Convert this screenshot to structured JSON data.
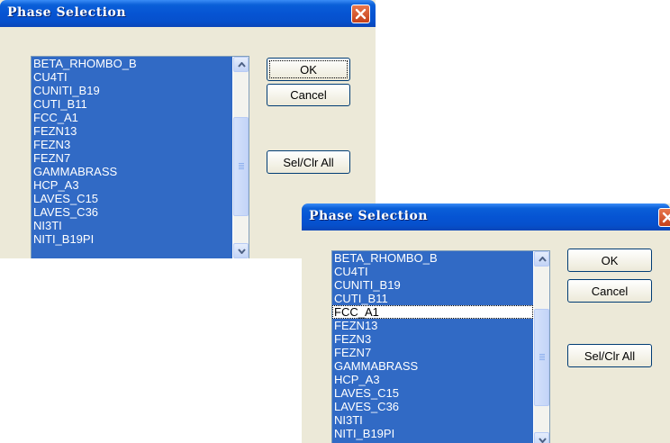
{
  "dialog_top": {
    "title": "Phase Selection",
    "phases": [
      "BETA_RHOMBO_B",
      "CU4TI",
      "CUNITI_B19",
      "CUTI_B11",
      "FCC_A1",
      "FEZN13",
      "FEZN3",
      "FEZN7",
      "GAMMABRASS",
      "HCP_A3",
      "LAVES_C15",
      "LAVES_C36",
      "NI3TI",
      "NITI_B19PI"
    ],
    "ok_label": "OK",
    "cancel_label": "Cancel",
    "select_clear_label": "Sel/Clr All"
  },
  "dialog_bottom": {
    "title": "Phase Selection",
    "phases": [
      "BETA_RHOMBO_B",
      "CU4TI",
      "CUNITI_B19",
      "CUTI_B11",
      "FCC_A1",
      "FEZN13",
      "FEZN3",
      "FEZN7",
      "GAMMABRASS",
      "HCP_A3",
      "LAVES_C15",
      "LAVES_C36",
      "NI3TI",
      "NITI_B19PI"
    ],
    "deselected_item": "FCC_A1",
    "ok_label": "OK",
    "cancel_label": "Cancel",
    "select_clear_label": "Sel/Clr All"
  },
  "colors": {
    "title_bar": "#0654d3",
    "selection": "#316ac5",
    "dialog_face": "#ece9d8",
    "close_button": "#d9532a"
  }
}
